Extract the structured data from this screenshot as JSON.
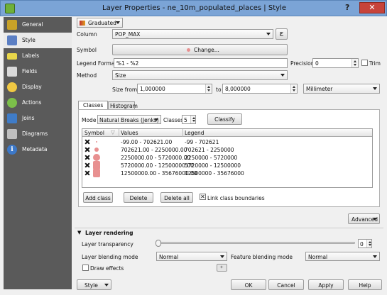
{
  "window": {
    "title": "Layer Properties - ne_10m_populated_places | Style",
    "help": "?",
    "close": "✕"
  },
  "sidebar": {
    "items": [
      {
        "label": "General",
        "icon": "wrench-screwdriver-icon",
        "color": "#c9a227"
      },
      {
        "label": "Style",
        "icon": "brush-icon",
        "color": "#5b7fc4",
        "selected": true
      },
      {
        "label": "Labels",
        "icon": "abc-label-icon",
        "color": "#e8d64a"
      },
      {
        "label": "Fields",
        "icon": "table-fields-icon",
        "color": "#d9d9d9"
      },
      {
        "label": "Display",
        "icon": "speech-bubble-icon",
        "color": "#f0c843"
      },
      {
        "label": "Actions",
        "icon": "gears-icon",
        "color": "#7cbf4a"
      },
      {
        "label": "Joins",
        "icon": "join-arrow-icon",
        "color": "#3f7cc8"
      },
      {
        "label": "Diagrams",
        "icon": "diagram-icon",
        "color": "#bfbfbf"
      },
      {
        "label": "Metadata",
        "icon": "info-icon",
        "color": "#3c78c8"
      }
    ]
  },
  "renderer": {
    "value": "Graduated"
  },
  "column": {
    "label": "Column",
    "value": "POP_MAX",
    "expr_btn": "ε"
  },
  "symbol": {
    "label": "Symbol",
    "change_btn": "Change..."
  },
  "legend_format": {
    "label": "Legend Format",
    "value": "%1 - %2"
  },
  "precision": {
    "label": "Precision",
    "value": "0",
    "trim_label": "Trim"
  },
  "method": {
    "label": "Method",
    "value": "Size"
  },
  "size": {
    "from_label": "Size from",
    "from_value": "1,000000",
    "to_label": "to",
    "to_value": "8,000000",
    "unit": "Millimeter"
  },
  "tabs": {
    "classes": "Classes",
    "histogram": "Histogram"
  },
  "mode": {
    "label": "Mode",
    "value": "Natural Breaks (Jenks)",
    "classes_label": "Classes",
    "classes_value": "5",
    "classify_btn": "Classify"
  },
  "table": {
    "headers": [
      "Symbol",
      "Values",
      "Legend"
    ],
    "rows": [
      {
        "values": "-99.00 - 702621.00",
        "legend": "-99 - 702621",
        "size": 2
      },
      {
        "values": "702621.00 - 2250000.00",
        "legend": "702621 - 2250000",
        "size": 5
      },
      {
        "values": "2250000.00 - 5720000.00",
        "legend": "2250000 - 5720000",
        "size": 9
      },
      {
        "values": "5720000.00 - 12500000.00",
        "legend": "5720000 - 12500000",
        "size": 11
      },
      {
        "values": "12500000.00 - 35676000.00",
        "legend": "12500000 - 35676000",
        "size": 13
      }
    ],
    "symbol_color": "#e89090"
  },
  "buttons": {
    "add_class": "Add class",
    "delete": "Delete",
    "delete_all": "Delete all",
    "link_label": "Link class boundaries",
    "advanced": "Advanced"
  },
  "layer_rendering": {
    "title": "Layer rendering",
    "transparency_label": "Layer transparency",
    "transparency_value": "0",
    "blending_label": "Layer blending mode",
    "blending_value": "Normal",
    "feature_blending_label": "Feature blending mode",
    "feature_blending_value": "Normal",
    "draw_effects_label": "Draw effects"
  },
  "footer": {
    "style": "Style",
    "ok": "OK",
    "cancel": "Cancel",
    "apply": "Apply",
    "help": "Help"
  }
}
